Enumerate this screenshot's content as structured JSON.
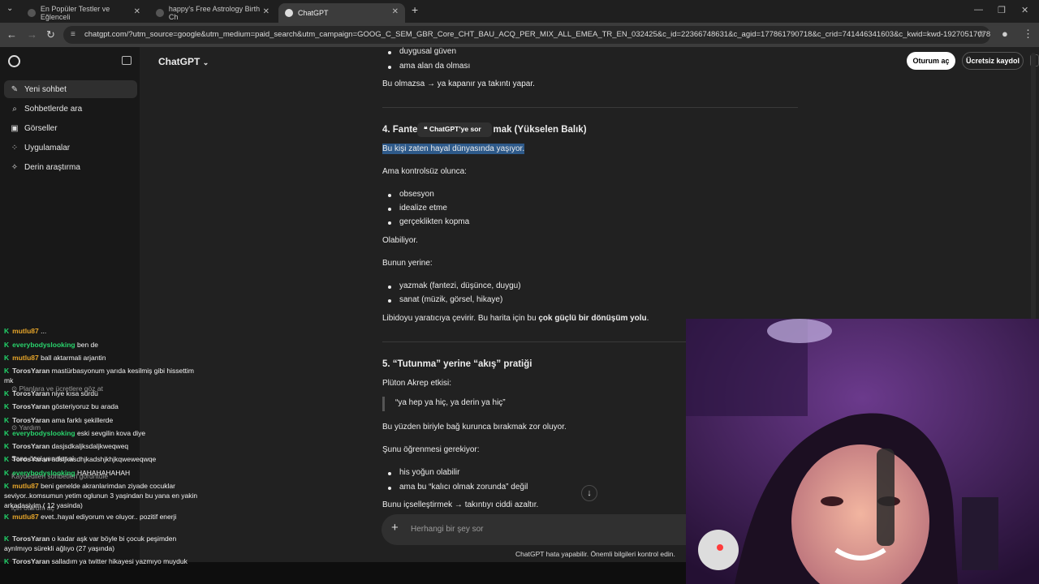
{
  "browser": {
    "tabs": [
      {
        "title": "En Popüler Testler ve Eğlenceli"
      },
      {
        "title": "happy's Free Astrology Birth Ch"
      },
      {
        "title": "ChatGPT"
      }
    ],
    "url": "chatgpt.com/?utm_source=google&utm_medium=paid_search&utm_campaign=GOOG_C_SEM_GBR_Core_CHT_BAU_ACQ_PER_MIX_ALL_EMEA_TR_EN_032425&c_id=22366748631&c_agid=177861790718&c_crid=741446341603&c_kwid=kwd-1927051707828&c_i..."
  },
  "sidebar": {
    "items": [
      {
        "label": "Yeni sohbet",
        "icon": "edit-icon"
      },
      {
        "label": "Sohbetlerde ara",
        "icon": "search-icon"
      },
      {
        "label": "Görseller",
        "icon": "images-icon"
      },
      {
        "label": "Uygulamalar",
        "icon": "apps-icon"
      },
      {
        "label": "Derin araştırma",
        "icon": "research-icon"
      }
    ],
    "ghost": {
      "plans": "Planlara ve ücretlere göz at",
      "help": "Yardım",
      "save_title": "Sana özel yanıtlar al",
      "save_sub": "Kaydedilen sohbetleri görüntüle",
      "save_sub2": "için oturum aç"
    }
  },
  "header": {
    "model": "ChatGPT",
    "login": "Oturum aç",
    "signup": "Ücretsiz kaydol"
  },
  "content": {
    "top_bullets": [
      "duygusal güven",
      "ama alan da olması"
    ],
    "p1": "Bu olmazsa → ya kapanır ya takıntı yapar.",
    "h4_start": "4. Fante",
    "h4_end": "mak (Yükselen Balık)",
    "popup": "ChatGPT’ye sor",
    "selected": "Bu kişi zaten hayal dünyasında yaşıyor.",
    "p2": "Ama kontrolsüz olunca:",
    "bullets2": [
      "obsesyon",
      "idealize etme",
      "gerçeklikten kopma"
    ],
    "p3": "Olabiliyor.",
    "p4": "Bunun yerine:",
    "bullets3": [
      "yazmak (fantezi, düşünce, duygu)",
      "sanat (müzik, görsel, hikaye)"
    ],
    "p5_start": "Libidoyu yaratıcıya çevirir. Bu harita için bu ",
    "p5_bold": "çok güçlü bir dönüşüm yolu",
    "p5_end": ".",
    "h5": "5. “Tutunma” yerine “akış” pratiği",
    "p6": "Plüton Akrep etkisi:",
    "quote": "“ya hep ya hiç, ya derin ya hiç”",
    "p7": "Bu yüzden biriyle bağ kurunca bırakmak zor oluyor.",
    "p8": "Şunu öğrenmesi gerekiyor:",
    "bullets4": [
      "his yoğun olabilir",
      "ama bu “kalıcı olmak zorunda” değil"
    ],
    "p9": "Bunu içselleştirmek → takıntıyı ciddi azaltır."
  },
  "composer": {
    "placeholder": "Herhangi bir şey sor"
  },
  "disclaimer": "ChatGPT hata yapabilir. Önemli bilgileri kontrol edin.",
  "chat_overlay": [
    {
      "user": "mutlu87",
      "msg": "..."
    },
    {
      "user": "everybodyslooking",
      "msg": "ben de"
    },
    {
      "user": "mutlu87",
      "msg": "ball aktarmali arjantin"
    },
    {
      "user": "TorosYaran",
      "msg": "mastürbasyonum yarıda kesilmiş gibi hissettim mk"
    },
    {
      "user": "TorosYaran",
      "msg": "niye kısa sürdü"
    },
    {
      "user": "TorosYaran",
      "msg": "gösteriyoruz bu arada"
    },
    {
      "user": "TorosYaran",
      "msg": "ama farklı şekillerde"
    },
    {
      "user": "everybodyslooking",
      "msg": "eski sevgilin kova diye"
    },
    {
      "user": "TorosYaran",
      "msg": "dasjsdkaljksdaljkweqweq"
    },
    {
      "user": "TorosYaran",
      "msg": "adsljkasdhjkadshjkhjkqweweqwqe"
    },
    {
      "user": "everybodyslooking",
      "msg": "HAHAHAHAHAH"
    },
    {
      "user": "mutlu87",
      "msg": "beni genelde akranlarimdan ziyade cocuklar seviyor..komsumun yetim oglunun 3 yaşindan bu yana en yakin arkadasiyim ( 12 yasinda)"
    },
    {
      "user": "mutlu87",
      "msg": "evet..hayal ediyorum ve oluyor.. pozitif enerji"
    },
    {
      "user": "TorosYaran",
      "msg": "o kadar aşk var böyle bi çocuk peşimden ayrılmıyo sürekli ağlıyo (27 yaşında)"
    },
    {
      "user": "TorosYaran",
      "msg": "salladım ya twitter hikayesi yazmıyo muyduk"
    }
  ],
  "colors": {
    "accent_selection": "#2e5a8a",
    "chat_mutlu87": "#e6a52a",
    "chat_everybodyslooking": "#29d36c"
  }
}
